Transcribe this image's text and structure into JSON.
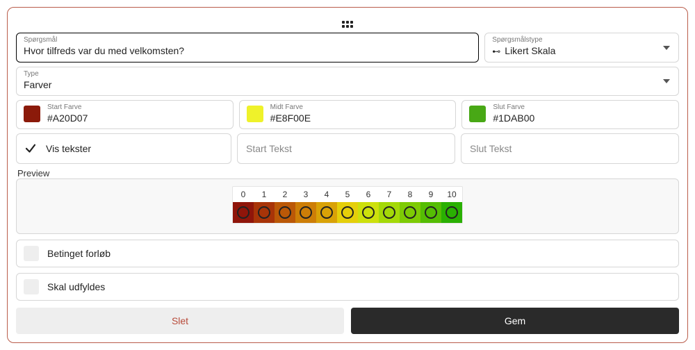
{
  "question": {
    "label": "Spørgsmål",
    "value": "Hvor tilfreds var du med velkomsten?"
  },
  "question_type": {
    "label": "Spørgsmålstype",
    "value": "Likert Skala"
  },
  "type_field": {
    "label": "Type",
    "value": "Farver"
  },
  "colors": {
    "start": {
      "label": "Start Farve",
      "value": "#A20D07",
      "swatch": "#8b1a0a"
    },
    "mid": {
      "label": "Midt Farve",
      "value": "#E8F00E",
      "swatch": "#eff22a"
    },
    "end": {
      "label": "Slut Farve",
      "value": "#1DAB00",
      "swatch": "#48a815"
    }
  },
  "texts": {
    "show_label": "Vis tekster",
    "start_placeholder": "Start Tekst",
    "end_placeholder": "Slut Tekst"
  },
  "preview": {
    "label": "Preview",
    "numbers": [
      "0",
      "1",
      "2",
      "3",
      "4",
      "5",
      "6",
      "7",
      "8",
      "9",
      "10"
    ],
    "cell_colors": [
      "#8f150a",
      "#a83408",
      "#bb5807",
      "#cd7e07",
      "#d9a207",
      "#e5cf0a",
      "#cde00c",
      "#a4d908",
      "#7ecb05",
      "#55bd04",
      "#2ab002"
    ]
  },
  "options": {
    "conditional": "Betinget forløb",
    "required": "Skal udfyldes"
  },
  "buttons": {
    "delete": "Slet",
    "save": "Gem"
  }
}
